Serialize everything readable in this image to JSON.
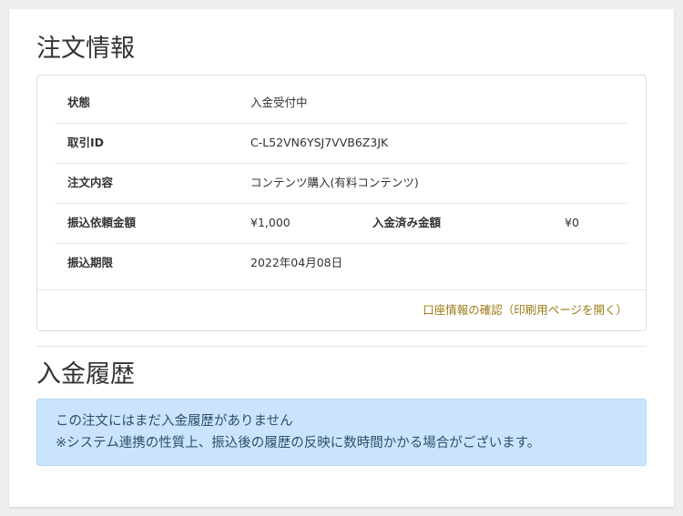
{
  "order": {
    "title": "注文情報",
    "rows": [
      {
        "label": "状態",
        "value": "入金受付中"
      },
      {
        "label": "取引ID",
        "value": "C-L52VN6YSJ7VVB6Z3JK"
      },
      {
        "label": "注文内容",
        "value": "コンテンツ購入(有料コンテンツ)"
      },
      {
        "label": "振込依頼金額",
        "value": "¥1,000",
        "label2": "入金済み金額",
        "value2": "¥0"
      },
      {
        "label": "振込期限",
        "value": "2022年04月08日"
      }
    ],
    "account_link": "口座情報の確認（印刷用ページを開く）"
  },
  "history": {
    "title": "入金履歴",
    "message_line1": "この注文にはまだ入金履歴がありません",
    "message_line2": "※システム連携の性質上、振込後の履歴の反映に数時間かかる場合がございます。"
  },
  "colors": {
    "link": "#9a7a13",
    "alert_bg": "#c9e4fb",
    "alert_text": "#2f5068"
  }
}
